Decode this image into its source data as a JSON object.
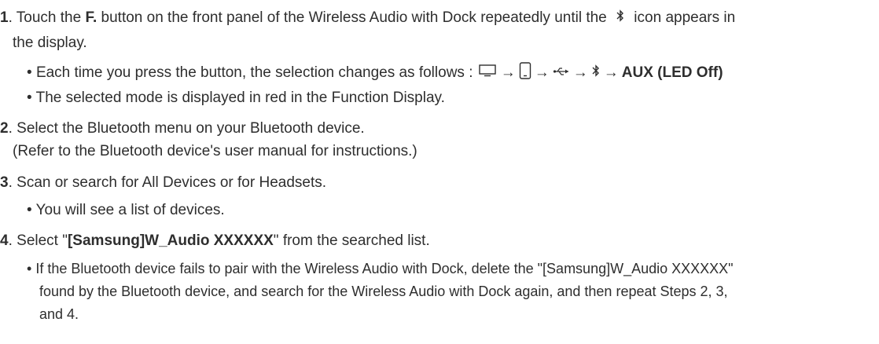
{
  "steps": [
    {
      "number": "1",
      "text_before_bold": "Touch the ",
      "bold": "F.",
      "text_after_bold": " button on the front panel of the Wireless Audio with Dock repeatedly until the ",
      "text_after_icon": " icon appears in",
      "continuation": "the display.",
      "icon": "bluetooth-icon",
      "bullets": [
        {
          "text": "Each time you press the button, the selection changes as follows : ",
          "sequence_icons": [
            "tv-icon",
            "phone-icon",
            "usb-icon",
            "bluetooth-icon"
          ],
          "sequence_end_bold": "AUX (LED Off)"
        },
        {
          "text": "The selected mode is displayed in red in the Function Display."
        }
      ]
    },
    {
      "number": "2",
      "text": "Select the Bluetooth menu on your Bluetooth device.",
      "continuation": "(Refer to the Bluetooth device's user manual for instructions.)"
    },
    {
      "number": "3",
      "text": "Scan or search for All Devices or for Headsets.",
      "bullets": [
        {
          "text": "You will see a list of devices."
        }
      ]
    },
    {
      "number": "4",
      "text_before_bold": "Select \"",
      "bold": "[Samsung]W_Audio XXXXXX",
      "text_after_bold": "\" from the searched list.",
      "bullets": [
        {
          "lines": [
            "If the Bluetooth device fails to pair with the Wireless Audio with Dock, delete the \"[Samsung]W_Audio XXXXXX\"",
            "found by the Bluetooth device, and search for the Wireless Audio with Dock again, and then repeat Steps 2, 3,",
            "and 4."
          ]
        }
      ]
    }
  ],
  "bullet_char": "•",
  "arrow_char": "→",
  "number_suffix": "."
}
